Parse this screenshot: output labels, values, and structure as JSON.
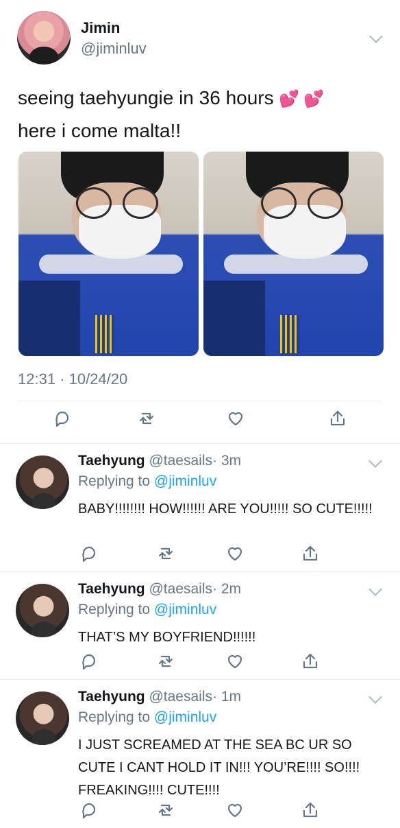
{
  "tweet": {
    "author_name": "Jimin",
    "author_handle": "@jiminluv",
    "text_line1": "seeing taehyungie in 36 hours",
    "hearts": "💕💕",
    "text_line2": "here i come malta!!",
    "timestamp": "12:31 · 10/24/20"
  },
  "icons": {
    "reply": "reply-icon",
    "retweet": "retweet-icon",
    "like": "like-icon",
    "share": "share-icon",
    "more": "chevron-down-icon"
  },
  "replies": [
    {
      "name": "Taehyung",
      "handle": "@taesails",
      "time": "· 3m",
      "replying_label": "Replying to",
      "replying_to": "@jiminluv",
      "body": "BABY!!!!!!!! HOW!!!!!! ARE YOU!!!!! SO CUTE!!!!!"
    },
    {
      "name": "Taehyung",
      "handle": "@taesails",
      "time": "· 2m",
      "replying_label": "Replying to",
      "replying_to": "@jiminluv",
      "body": "THAT’S MY BOYFRIEND!!!!!!"
    },
    {
      "name": "Taehyung",
      "handle": "@taesails",
      "time": "· 1m",
      "replying_label": "Replying to",
      "replying_to": "@jiminluv",
      "body": "I JUST SCREAMED AT THE SEA BC UR SO CUTE I CANT HOLD IT IN!!! YOU’RE!!!! SO!!!! FREAKING!!!! CUTE!!!!"
    }
  ],
  "colors": {
    "link": "#1da1f2",
    "secondary_text": "#657786",
    "divider": "#e6ecf0"
  }
}
